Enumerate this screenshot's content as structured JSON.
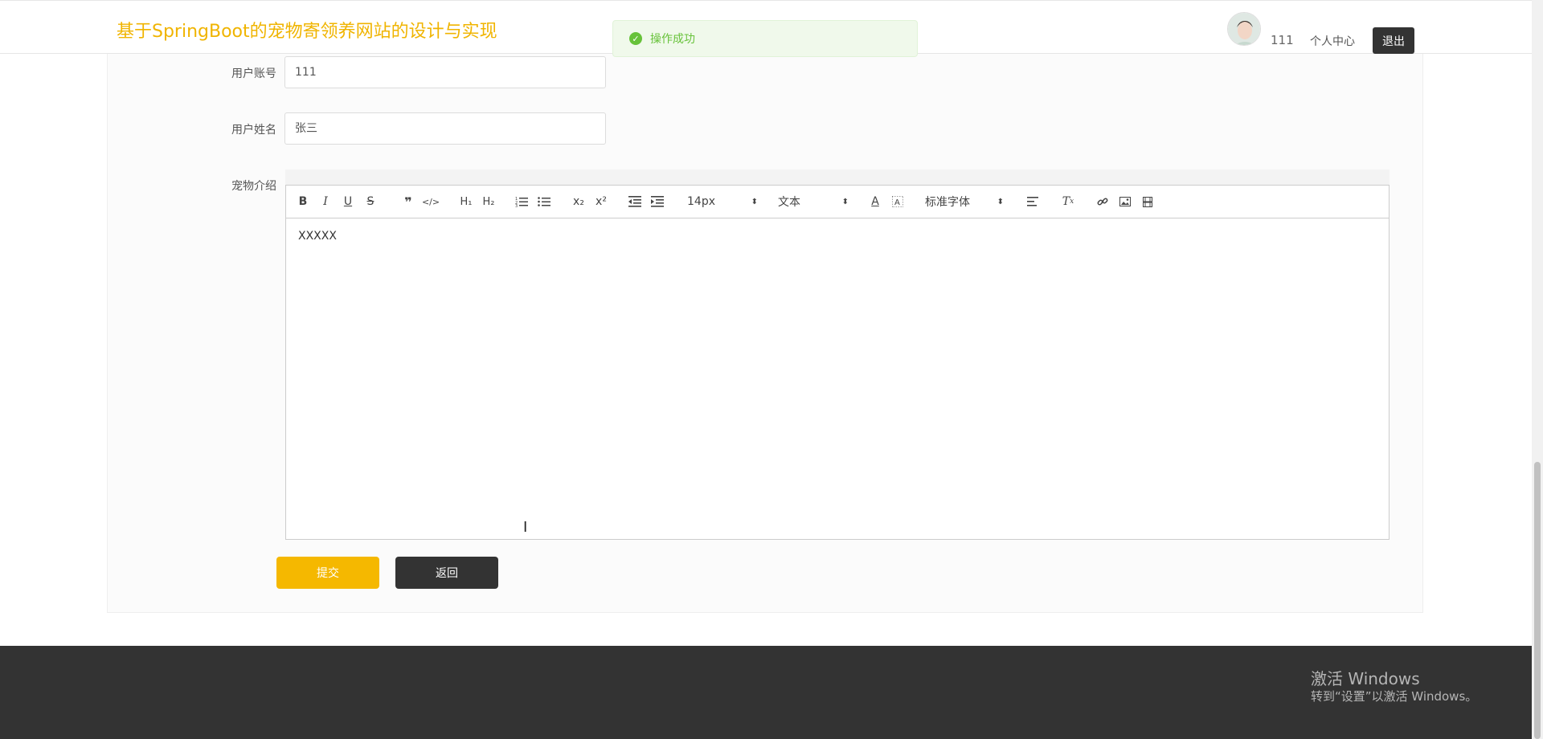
{
  "header": {
    "site_title": "基于SpringBoot的宠物寄领养网站的设计与实现",
    "username": "111",
    "profile_link": "个人中心",
    "logout": "退出"
  },
  "toast": {
    "message": "操作成功",
    "icon": "check-circle-icon",
    "color": "#67c23a"
  },
  "form": {
    "account_label": "用户账号",
    "account_value": "111",
    "name_label": "用户姓名",
    "name_value": "张三",
    "intro_label": "宠物介绍",
    "editor": {
      "font_size": "14px",
      "text_type": "文本",
      "font_family": "标准字体",
      "content": "XXXXX"
    },
    "submit": "提交",
    "back": "返回"
  },
  "watermark": {
    "title": "激活 Windows",
    "subtitle": "转到“设置”以激活 Windows。"
  },
  "colors": {
    "brand": "#f0b400",
    "submit": "#f5b800",
    "dark": "#333333"
  }
}
